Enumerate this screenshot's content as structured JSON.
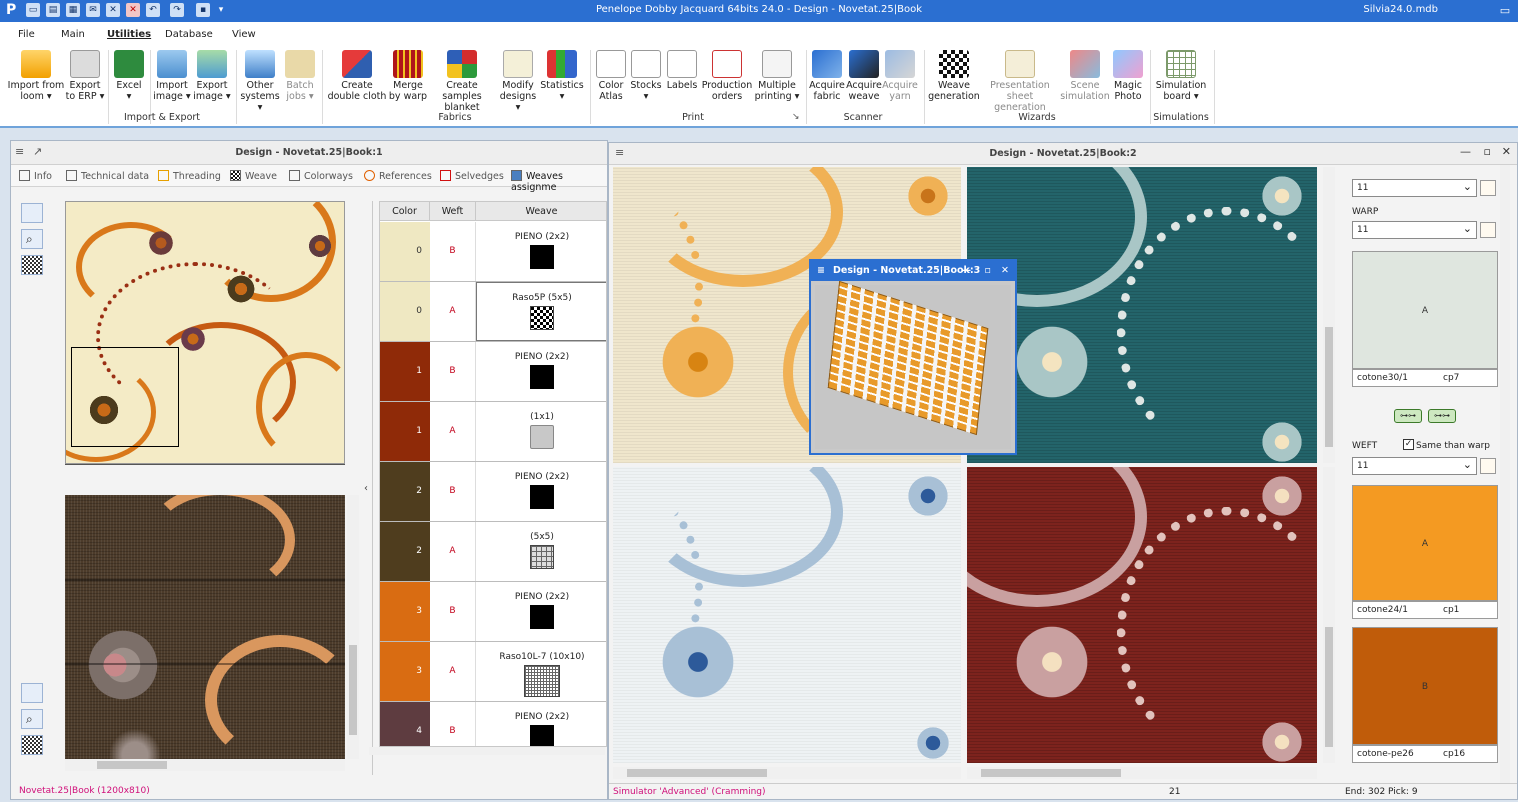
{
  "app": {
    "title": "Penelope Dobby Jacquard 64bits 24.0 - Design - Novetat.25|Book",
    "database": "Silvia24.0.mdb",
    "logo": "P"
  },
  "menu": {
    "items": [
      "File",
      "Main",
      "Utilities",
      "Database",
      "View"
    ],
    "active": "Utilities"
  },
  "ribbon": {
    "groups": [
      {
        "label": "Import & Export"
      },
      {
        "label": "Fabrics"
      },
      {
        "label": "Print"
      },
      {
        "label": "Scanner"
      },
      {
        "label": "Wizards"
      },
      {
        "label": "Simulations"
      }
    ],
    "buttons": [
      {
        "l1": "Import from",
        "l2": "loom ▾"
      },
      {
        "l1": "Export",
        "l2": "to ERP ▾"
      },
      {
        "l1": "Excel",
        "l2": "▾"
      },
      {
        "l1": "Import",
        "l2": "image ▾"
      },
      {
        "l1": "Export",
        "l2": "image ▾"
      },
      {
        "l1": "Other",
        "l2": "systems ▾"
      },
      {
        "l1": "Batch",
        "l2": "jobs ▾"
      },
      {
        "l1": "Create",
        "l2": "double cloth"
      },
      {
        "l1": "Merge",
        "l2": "by warp"
      },
      {
        "l1": "Create samples",
        "l2": "blanket"
      },
      {
        "l1": "Modify",
        "l2": "designs ▾"
      },
      {
        "l1": "Statistics",
        "l2": "▾"
      },
      {
        "l1": "Color",
        "l2": "Atlas"
      },
      {
        "l1": "Stocks",
        "l2": "▾"
      },
      {
        "l1": "Labels",
        "l2": ""
      },
      {
        "l1": "Production",
        "l2": "orders"
      },
      {
        "l1": "Multiple",
        "l2": "printing ▾"
      },
      {
        "l1": "Acquire",
        "l2": "fabric"
      },
      {
        "l1": "Acquire",
        "l2": "weave"
      },
      {
        "l1": "Acquire",
        "l2": "yarn"
      },
      {
        "l1": "Weave",
        "l2": "generation"
      },
      {
        "l1": "Presentation",
        "l2": "sheet generation"
      },
      {
        "l1": "Scene",
        "l2": "simulation"
      },
      {
        "l1": "Magic",
        "l2": "Photo"
      },
      {
        "l1": "Simulation",
        "l2": "board ▾"
      }
    ]
  },
  "book1": {
    "title": "Design - Novetat.25|Book:1",
    "tabs": [
      "Info",
      "Technical data",
      "Threading",
      "Weave",
      "Colorways",
      "References",
      "Selvedges",
      "Weaves assignme"
    ],
    "table": {
      "headers": [
        "Color",
        "Weft",
        "Weave"
      ],
      "rows": [
        {
          "color": "0",
          "weft": "B",
          "weave": "PIENO (2x2)",
          "swatch": "#efe8c2"
        },
        {
          "color": "0",
          "weft": "A",
          "weave": "Raso5P (5x5)",
          "swatch": "#efe8c2"
        },
        {
          "color": "1",
          "weft": "B",
          "weave": "PIENO (2x2)",
          "swatch": "#8f2a08"
        },
        {
          "color": "1",
          "weft": "A",
          "weave": "(1x1)",
          "swatch": "#8f2a08"
        },
        {
          "color": "2",
          "weft": "B",
          "weave": "PIENO (2x2)",
          "swatch": "#4f3d1e"
        },
        {
          "color": "2",
          "weft": "A",
          "weave": "(5x5)",
          "swatch": "#4f3d1e"
        },
        {
          "color": "3",
          "weft": "B",
          "weave": "PIENO (2x2)",
          "swatch": "#d96c12"
        },
        {
          "color": "3",
          "weft": "A",
          "weave": "Raso10L-7 (10x10)",
          "swatch": "#d96c12"
        },
        {
          "color": "4",
          "weft": "B",
          "weave": "PIENO (2x2)",
          "swatch": "#5e3c40"
        }
      ]
    },
    "status": "Novetat.25|Book  (1200x810)"
  },
  "book2": {
    "title": "Design - Novetat.25|Book:2",
    "status_left": "Simulator 'Advanced' (Cramming)",
    "status_mid": "21",
    "status_right": "End: 302 Pick: 9"
  },
  "book3": {
    "title": "Design - Novetat.25|Book:3"
  },
  "yarn_panel": {
    "top_combo": "11",
    "warp_label": "WARP",
    "warp_combo": "11",
    "warp_swatch": {
      "letter": "A",
      "name": "cotone30/1",
      "code": "cp7",
      "color": "#dfe6df"
    },
    "weft_label": "WEFT",
    "same_label": "Same than warp",
    "weft_combo": "11",
    "weft_swatches": [
      {
        "letter": "A",
        "name": "cotone24/1",
        "code": "cp1",
        "color": "#f49a22"
      },
      {
        "letter": "B",
        "name": "cotone-pe26",
        "code": "cp16",
        "color": "#c05c0a"
      }
    ]
  }
}
